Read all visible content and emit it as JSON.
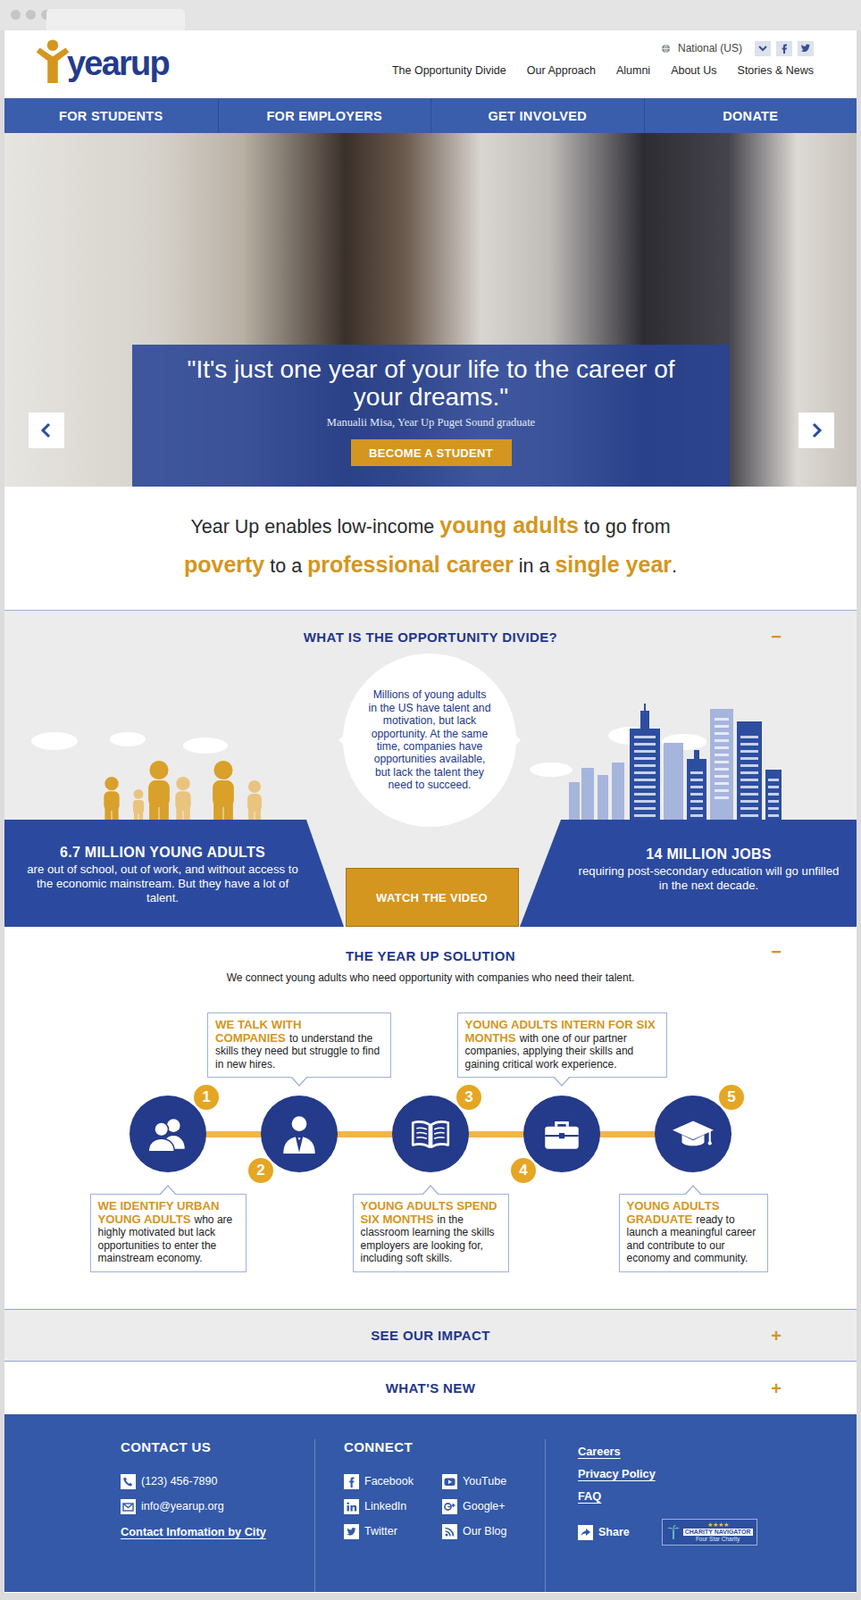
{
  "header": {
    "logo": "yearup",
    "region": "National (US)",
    "nav": [
      "The Opportunity Divide",
      "Our Approach",
      "Alumni",
      "About Us",
      "Stories & News"
    ]
  },
  "main_nav": [
    "FOR STUDENTS",
    "FOR EMPLOYERS",
    "GET INVOLVED",
    "DONATE"
  ],
  "hero": {
    "quote": "\"It's just one year of your life to the career of your dreams.\"",
    "attribution": "Manualii Misa, Year Up Puget Sound graduate",
    "button": "BECOME A STUDENT"
  },
  "tagline": [
    [
      {
        "text": "Year Up enables low-income ",
        "kind": "plain"
      },
      {
        "text": "young adults",
        "kind": "accent"
      },
      {
        "text": " to go from",
        "kind": "plain"
      }
    ],
    [
      {
        "text": "poverty",
        "kind": "accent"
      },
      {
        "text": " to a ",
        "kind": "plain"
      },
      {
        "text": "professional career",
        "kind": "accent"
      },
      {
        "text": " in a ",
        "kind": "plain"
      },
      {
        "text": "single year",
        "kind": "accent"
      },
      {
        "text": ".",
        "kind": "plain"
      }
    ]
  ],
  "opportunity": {
    "title": "WHAT IS THE OPPORTUNITY DIVIDE?",
    "toggle": "−",
    "expanded": true,
    "bubble": "Millions of young adults in the US have talent and motivation, but lack opportunity. At the same time, companies have opportunities available, but lack the talent they need to succeed.",
    "left_stat": {
      "title": "6.7 MILLION YOUNG ADULTS",
      "text": "are out of school, out of work, and without access to the economic mainstream. But they have a lot of talent."
    },
    "button": "WATCH THE VIDEO",
    "right_stat": {
      "title": "14 MILLION JOBS",
      "text": "requiring post-secondary education will go unfilled in the next decade."
    }
  },
  "solution": {
    "title": "THE YEAR UP SOLUTION",
    "toggle": "−",
    "expanded": true,
    "subtitle": "We connect young adults who need opportunity with companies who need their talent.",
    "steps": [
      {
        "number": "1",
        "title": "WE IDENTIFY URBAN YOUNG ADULTS",
        "text": "who are highly motivated but lack opportunities to enter the mainstream economy."
      },
      {
        "number": "2",
        "title": "WE TALK WITH COMPANIES",
        "text": "to understand the skills they need but struggle to find in new hires."
      },
      {
        "number": "3",
        "title": "YOUNG ADULTS SPEND SIX MONTHS",
        "text": "in the classroom learning the skills employers are looking for, including soft skills."
      },
      {
        "number": "4",
        "title": "YOUNG ADULTS INTERN FOR SIX MONTHS",
        "text": "with one of our partner companies, applying their skills and gaining critical work experience."
      },
      {
        "number": "5",
        "title": "YOUNG ADULTS GRADUATE",
        "text": "ready to launch a meaningful career and contribute to our economy and community."
      }
    ]
  },
  "collapsed_sections": [
    {
      "title": "SEE OUR IMPACT",
      "toggle": "+",
      "expanded": false
    },
    {
      "title": "WHAT'S NEW",
      "toggle": "+",
      "expanded": false
    }
  ],
  "footer": {
    "contact": {
      "title": "CONTACT US",
      "items": [
        {
          "text": "(123) 456-7890",
          "kind": "phone"
        },
        {
          "text": "info@yearup.org",
          "kind": "email"
        }
      ],
      "link": "Contact Infomation by City"
    },
    "connect": {
      "title": "CONNECT",
      "items": [
        {
          "text": "Facebook",
          "kind": "facebook"
        },
        {
          "text": "YouTube",
          "kind": "youtube"
        },
        {
          "text": "LinkedIn",
          "kind": "linkedin"
        },
        {
          "text": "Google+",
          "kind": "googleplus"
        },
        {
          "text": "Twitter",
          "kind": "twitter"
        },
        {
          "text": "Our Blog",
          "kind": "rss"
        }
      ]
    },
    "links": [
      "Careers",
      "Privacy Policy",
      "FAQ"
    ],
    "share": "Share",
    "badge": {
      "title": "CHARITY NAVIGATOR",
      "stars": 4,
      "caption": "Four Star Charity"
    }
  }
}
